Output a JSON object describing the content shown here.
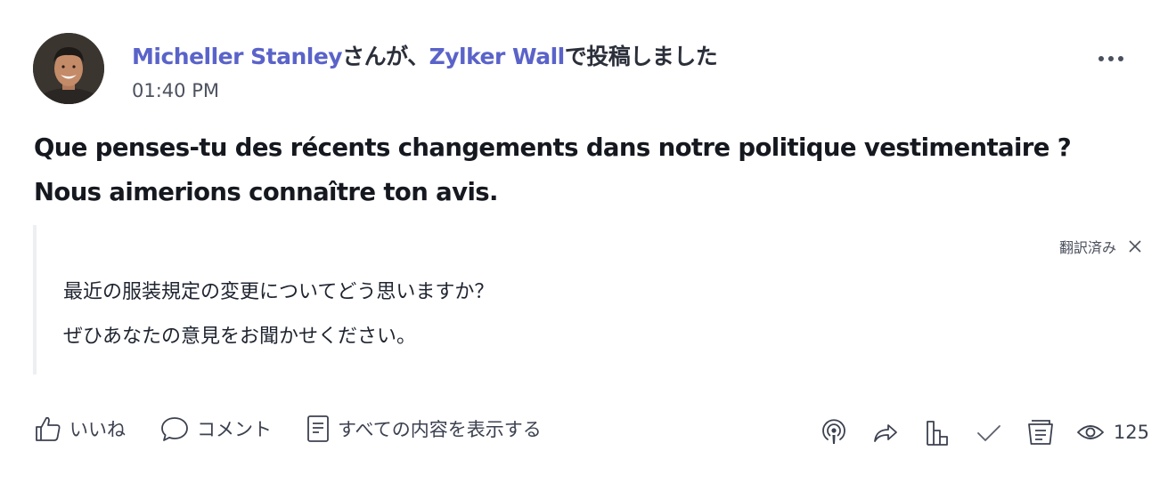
{
  "post": {
    "author": "Micheller Stanley",
    "joiner": "さんが、",
    "group": "Zylker Wall",
    "suffix": "で投稿しました",
    "time": "01:40 PM",
    "body": "Que penses-tu des récents changements dans notre politique vestimentaire ? Nous aimerions connaître ton avis."
  },
  "translation": {
    "label": "翻訳済み",
    "lines": [
      "最近の服装規定の変更についてどう思いますか？",
      "ぜひあなたの意見をお聞かせください。"
    ]
  },
  "actions": {
    "like": "いいね",
    "comment": "コメント",
    "view_full": "すべての内容を表示する"
  },
  "stats": {
    "views": "125"
  },
  "icons": [
    "more-icon",
    "close-icon",
    "like-icon",
    "comment-icon",
    "document-icon",
    "podcast-icon",
    "share-icon",
    "stats-icon",
    "check-icon",
    "notes-icon",
    "eye-icon"
  ]
}
